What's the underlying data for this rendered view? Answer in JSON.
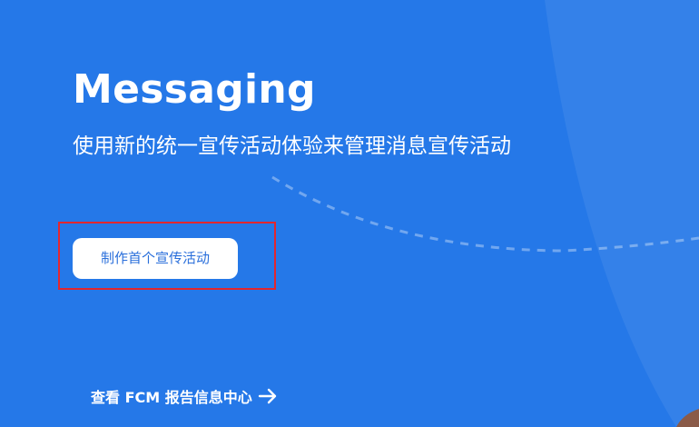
{
  "hero": {
    "title": "Messaging",
    "subtitle": "使用新的统一宣传活动体验来管理消息宣传活动",
    "cta_label": "制作首个宣传活动",
    "report_link_label": "查看 FCM 报告信息中心"
  },
  "colors": {
    "background": "#2578e8",
    "button_text": "#2a6fdb",
    "highlight_border": "#e3262e",
    "decoration": "#8a5a48"
  },
  "icons": {
    "report_link": "arrow-right-icon"
  }
}
